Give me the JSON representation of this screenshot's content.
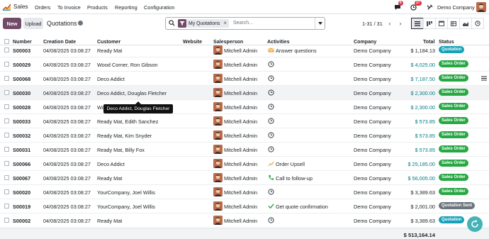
{
  "topbar": {
    "app_title": "Sales",
    "menu": [
      "Orders",
      "To Invoice",
      "Products",
      "Reporting",
      "Configuration"
    ],
    "chat_count": "6",
    "activity_count": "27",
    "company": "Demo Company",
    "icons": [
      "messages-icon",
      "clock-icon",
      "tools-icon"
    ]
  },
  "controls": {
    "new_label": "New",
    "upload_label": "Upload",
    "breadcrumb": "Quotations",
    "facet_label": "My Quotations",
    "search_placeholder": "Search...",
    "pager": "1-31 / 31"
  },
  "columns": {
    "number": "Number",
    "creation_date": "Creation Date",
    "customer": "Customer",
    "website": "Website",
    "salesperson": "Salesperson",
    "activities": "Activities",
    "company": "Company",
    "total": "Total",
    "status": "Status"
  },
  "rows": [
    {
      "number": "S00003",
      "date": "04/08/2025 03:08:27",
      "customer": "Ready Mat",
      "salesperson": "Mitchell Admin",
      "activity": "Answer questions",
      "activity_icon": "envelope-icon",
      "company": "Demo Company",
      "total": "$ 1,184.13",
      "total_color": "dark",
      "status": "Quotation",
      "status_color": "#17a2b8"
    },
    {
      "number": "S00029",
      "date": "04/08/2025 03:08:27",
      "customer": "Wood Corner, Ron Gibson",
      "salesperson": "Mitchell Admin",
      "activity": "",
      "activity_icon": "clock-icon",
      "company": "Demo Company",
      "total": "$ 4,025.00",
      "total_color": "blue",
      "status": "Sales Order",
      "status_color": "#28a745"
    },
    {
      "number": "S00068",
      "date": "04/08/2025 03:08:27",
      "customer": "Deco Addict",
      "salesperson": "Mitchell Admin",
      "activity": "",
      "activity_icon": "clock-icon",
      "company": "Demo Company",
      "total": "$ 7,187.50",
      "total_color": "blue",
      "status": "Sales Order",
      "status_color": "#28a745"
    },
    {
      "number": "S00030",
      "date": "04/08/2025 03:08:27",
      "customer": "Deco Addict, Douglas Fletcher",
      "salesperson": "Mitchell Admin",
      "activity": "",
      "activity_icon": "clock-icon",
      "company": "Demo Company",
      "total": "$ 2,300.00",
      "total_color": "blue",
      "status": "Sales Order",
      "status_color": "#28a745"
    },
    {
      "number": "S00028",
      "date": "04/08/2025 03:08:27",
      "customer": "Wo",
      "salesperson": "Mitchell Admin",
      "activity": "",
      "activity_icon": "clock-icon",
      "company": "Demo Company",
      "total": "$ 2,300.00",
      "total_color": "blue",
      "status": "Sales Order",
      "status_color": "#28a745"
    },
    {
      "number": "S00033",
      "date": "04/08/2025 03:08:27",
      "customer": "Ready Mat, Edith Sanchez",
      "salesperson": "Mitchell Admin",
      "activity": "",
      "activity_icon": "clock-icon",
      "company": "Demo Company",
      "total": "$ 573.85",
      "total_color": "blue",
      "status": "Sales Order",
      "status_color": "#28a745"
    },
    {
      "number": "S00032",
      "date": "04/08/2025 03:08:27",
      "customer": "Ready Mat, Kim Snyder",
      "salesperson": "Mitchell Admin",
      "activity": "",
      "activity_icon": "clock-icon",
      "company": "Demo Company",
      "total": "$ 573.85",
      "total_color": "blue",
      "status": "Sales Order",
      "status_color": "#28a745"
    },
    {
      "number": "S00031",
      "date": "04/08/2025 03:08:27",
      "customer": "Ready Mat, Billy Fox",
      "salesperson": "Mitchell Admin",
      "activity": "",
      "activity_icon": "clock-icon",
      "company": "Demo Company",
      "total": "$ 573.85",
      "total_color": "blue",
      "status": "Sales Order",
      "status_color": "#28a745"
    },
    {
      "number": "S00066",
      "date": "04/08/2025 03:08:27",
      "customer": "Deco Addict",
      "salesperson": "Mitchell Admin",
      "activity": "Order Upsell",
      "activity_icon": "upsell-chart-icon",
      "company": "Demo Company",
      "total": "$ 25,185.00",
      "total_color": "blue",
      "status": "Sales Order",
      "status_color": "#28a745"
    },
    {
      "number": "S00067",
      "date": "04/08/2025 03:08:27",
      "customer": "Ready Mat",
      "salesperson": "Mitchell Admin",
      "activity": "Call to follow-up",
      "activity_icon": "phone-icon",
      "company": "Demo Company",
      "total": "$ 56,005.00",
      "total_color": "blue",
      "status": "Sales Order",
      "status_color": "#28a745"
    },
    {
      "number": "S00020",
      "date": "04/08/2025 03:08:27",
      "customer": "YourCompany, Joel Willis",
      "salesperson": "Mitchell Admin",
      "activity": "",
      "activity_icon": "clock-icon",
      "company": "Demo Company",
      "total": "$ 3,389.63",
      "total_color": "dark",
      "status": "Sales Order",
      "status_color": "#28a745"
    },
    {
      "number": "S00019",
      "date": "04/08/2025 03:08:27",
      "customer": "YourCompany, Joel Willis",
      "salesperson": "Mitchell Admin",
      "activity": "Get quote confirmation",
      "activity_icon": "check-icon",
      "company": "Demo Company",
      "total": "$ 2,001.00",
      "total_color": "dark",
      "status": "Quotation Sent",
      "status_color": "#6c757d"
    },
    {
      "number": "S00002",
      "date": "04/08/2025 03:08:27",
      "customer": "Ready Mat",
      "salesperson": "Mitchell Admin",
      "activity": "",
      "activity_icon": "clock-icon",
      "company": "Demo Company",
      "total": "$ 3,389.63",
      "total_color": "dark",
      "status": "Quotation",
      "status_color": "#17a2b8"
    }
  ],
  "footer": {
    "grand_total": "$ 513,164.14"
  },
  "tooltip": {
    "text": "Deco Addict, Douglas Fletcher"
  }
}
